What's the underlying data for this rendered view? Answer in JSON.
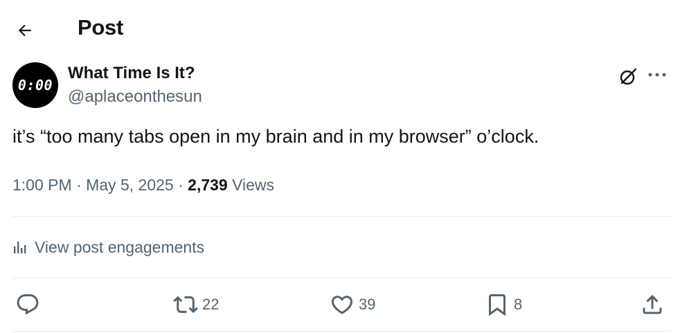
{
  "header": {
    "back_icon": "arrow-left-icon",
    "title": "Post"
  },
  "author": {
    "avatar_text": "0:00",
    "display_name": "What Time Is It?",
    "handle": "@aplaceonthesun"
  },
  "top_actions": {
    "grok_icon": "grok-icon",
    "more_icon": "more-horizontal-icon"
  },
  "post": {
    "text": "it’s “too many tabs open in my brain and in my browser” o’clock."
  },
  "meta": {
    "time": "1:00 PM",
    "separator": " · ",
    "date": "May 5, 2025",
    "views_count": "2,739",
    "views_label": " Views"
  },
  "engagements": {
    "icon": "analytics-icon",
    "label": "View post engagements"
  },
  "actions": {
    "reply": {
      "icon": "reply-icon",
      "count": ""
    },
    "repost": {
      "icon": "repost-icon",
      "count": "22"
    },
    "like": {
      "icon": "heart-icon",
      "count": "39"
    },
    "bookmark": {
      "icon": "bookmark-icon",
      "count": "8"
    },
    "share": {
      "icon": "share-icon"
    }
  },
  "colors": {
    "text_primary": "#0f1419",
    "text_secondary": "#536471",
    "divider": "#e6ecf0",
    "avatar_bg": "#000000"
  }
}
